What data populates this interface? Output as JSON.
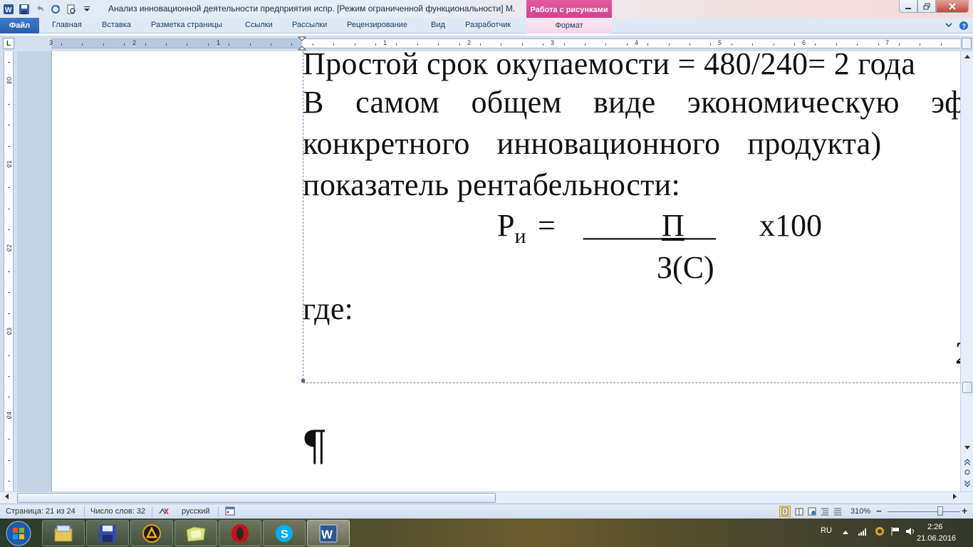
{
  "window": {
    "title": "Анализ инновационной деятельности предприятия испр. [Режим ограниченной функциональности]  M.",
    "context_tab_group": "Работа с рисунками"
  },
  "ribbon": {
    "tabs": [
      {
        "label": "Файл"
      },
      {
        "label": "Главная"
      },
      {
        "label": "Вставка"
      },
      {
        "label": "Разметка страницы"
      },
      {
        "label": "Ссылки"
      },
      {
        "label": "Рассылки"
      },
      {
        "label": "Рецензирование"
      },
      {
        "label": "Вид"
      },
      {
        "label": "Разработчик"
      },
      {
        "label": "Формат"
      }
    ]
  },
  "ruler": {
    "h_numbers": [
      "3",
      "2",
      "1",
      "1",
      "2",
      "3",
      "4",
      "5",
      "6",
      "7"
    ],
    "v_numbers": [
      "20",
      "21",
      "22",
      "23",
      "24"
    ]
  },
  "document": {
    "line1": "Простой срок окупаемости = 480/240= 2 года",
    "line2_words": [
      "В",
      "самом",
      "общем",
      "виде",
      "экономическую",
      "эф"
    ],
    "line3_words": [
      "конкретного",
      "инновационного",
      "продукта)"
    ],
    "line4": "показатель рентабельности:",
    "formula_lhs": "Р",
    "formula_sub": "и",
    "formula_eq": "=",
    "formula_underscores_left": "_____",
    "formula_numerator": "П",
    "formula_underscores_right": "__",
    "formula_mult": "х100",
    "formula_denominator": "З(С)",
    "line_where": "где:",
    "page_number_fragment": "2",
    "paragraph_mark": "¶"
  },
  "statusbar": {
    "page": "Страница: 21 из 24",
    "words": "Число слов: 32",
    "language": "русский",
    "zoom": "310%",
    "zoom_minus": "−",
    "zoom_plus": "+"
  },
  "taskbar": {
    "lang": "RU",
    "time": "2:26",
    "date": "21.06.2016",
    "apps": [
      "file-explorer",
      "save-disk",
      "aimp-player",
      "folder",
      "opera-browser",
      "skype",
      "microsoft-word"
    ]
  },
  "colors": {
    "file_tab": "#2a5fa8",
    "context_tab": "#d13f8a",
    "ruler_bg": "#d4dfee"
  }
}
